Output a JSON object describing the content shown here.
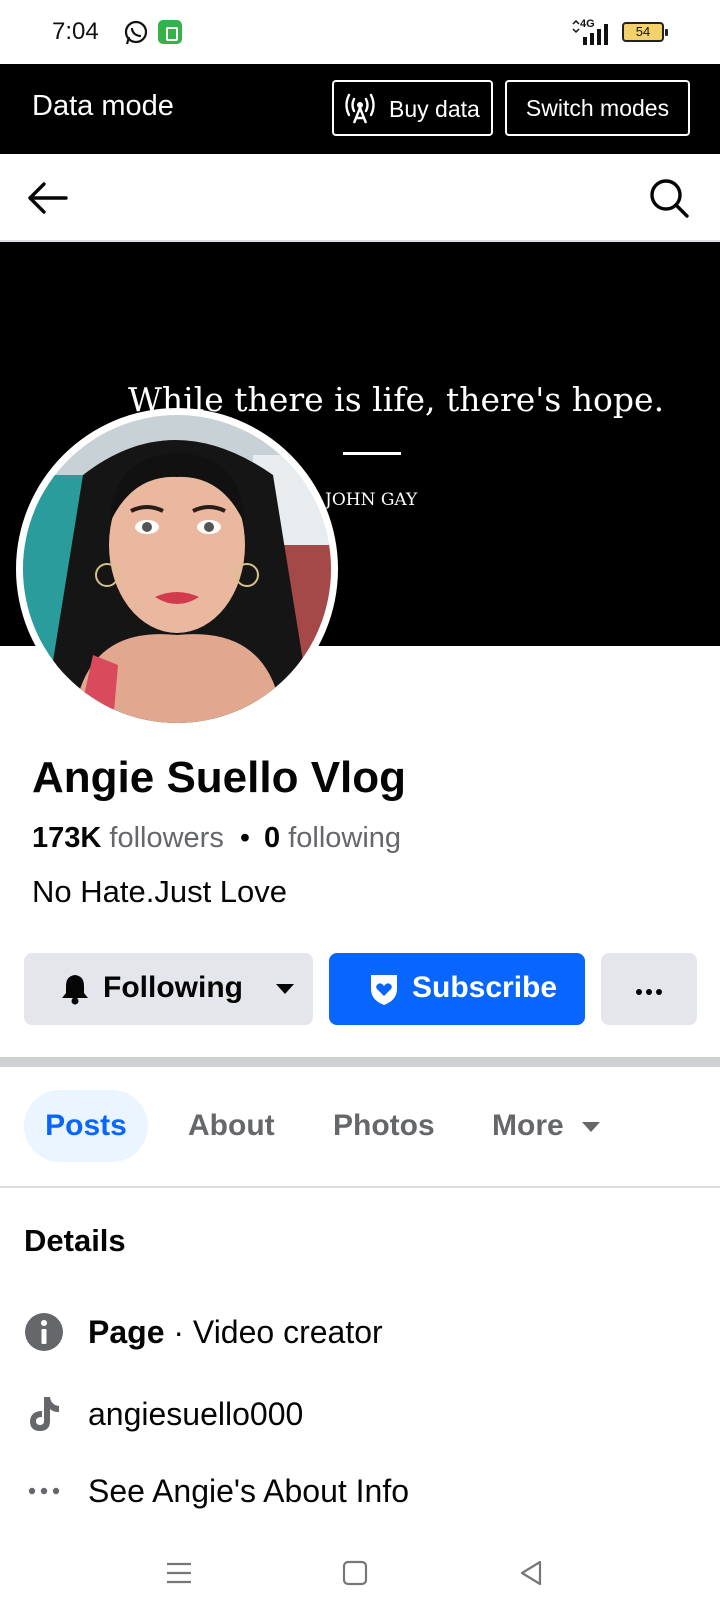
{
  "status_bar": {
    "time": "7:04",
    "network": "4G",
    "battery": "54",
    "icons": [
      "whatsapp-icon",
      "app-notification-icon",
      "signal-icon",
      "battery-icon"
    ]
  },
  "data_mode_bar": {
    "title": "Data mode",
    "buy_data_label": "Buy data",
    "switch_modes_label": "Switch modes"
  },
  "cover": {
    "quote": "While there is life, there's hope.",
    "author": "JOHN GAY"
  },
  "profile": {
    "name": "Angie Suello Vlog",
    "followers_count": "173K",
    "followers_label": "followers",
    "separator": "•",
    "following_count": "0",
    "following_label": "following",
    "bio": "No Hate.Just Love"
  },
  "actions": {
    "following_label": "Following",
    "subscribe_label": "Subscribe"
  },
  "tabs": [
    {
      "label": "Posts",
      "active": true
    },
    {
      "label": "About",
      "active": false
    },
    {
      "label": "Photos",
      "active": false
    },
    {
      "label": "More",
      "active": false
    }
  ],
  "details": {
    "title": "Details",
    "page_bold": "Page",
    "page_category": " · Video creator",
    "tiktok_handle": "angiesuello000",
    "see_about": "See Angie's About Info"
  },
  "colors": {
    "accent": "#0866ff",
    "secondary_text": "#65676b",
    "button_gray": "#e4e6eb"
  }
}
